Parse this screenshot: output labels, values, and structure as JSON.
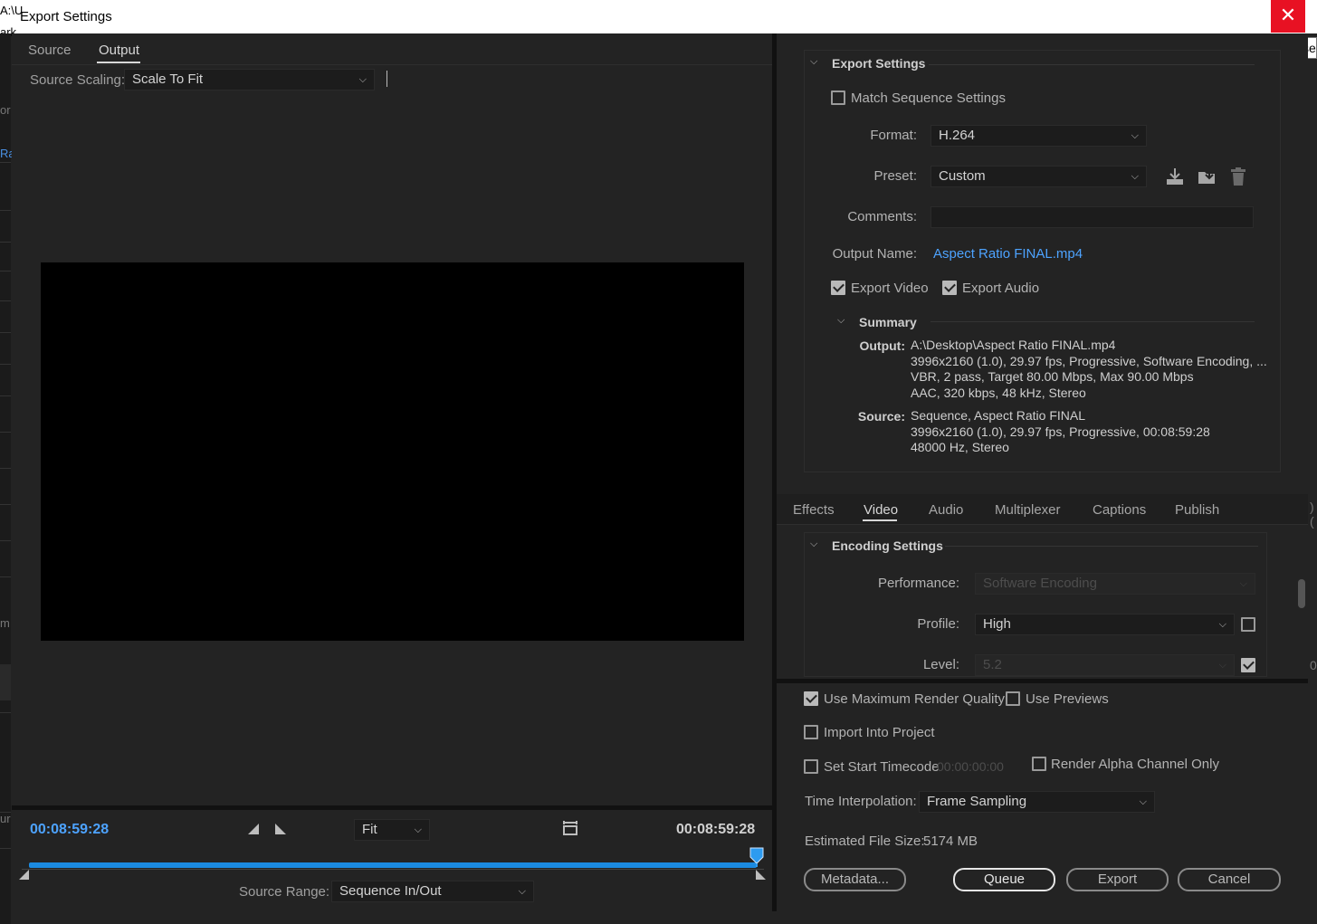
{
  "window": {
    "title": "Export Settings",
    "close_glyph": "✕",
    "close_tooltip": "Close"
  },
  "background_fragments": {
    "tl1": "A:\\U",
    "tl2": "ark",
    "or": "or",
    "ra": "Ra",
    "m": "m",
    "ur": "ur",
    "right1": ")(",
    "right2": "0"
  },
  "left_panel": {
    "tabs": [
      {
        "label": "Source"
      },
      {
        "label": "Output",
        "active": true
      }
    ],
    "source_scaling_label": "Source Scaling:",
    "source_scaling_value": "Scale To Fit",
    "timecode_in": "00:08:59:28",
    "timecode_out": "00:08:59:28",
    "zoom_value": "Fit",
    "source_range_label": "Source Range:",
    "source_range_value": "Sequence In/Out"
  },
  "export_settings": {
    "section_title": "Export Settings",
    "match_sequence_label": "Match Sequence Settings",
    "match_sequence_checked": false,
    "format_label": "Format:",
    "format_value": "H.264",
    "preset_label": "Preset:",
    "preset_value": "Custom",
    "comments_label": "Comments:",
    "comments_value": "",
    "output_name_label": "Output Name:",
    "output_name_value": "Aspect Ratio FINAL.mp4",
    "export_video_label": "Export Video",
    "export_video_checked": true,
    "export_audio_label": "Export Audio",
    "export_audio_checked": true
  },
  "summary": {
    "title": "Summary",
    "output_key": "Output:",
    "output_lines": [
      "A:\\Desktop\\Aspect Ratio FINAL.mp4",
      "3996x2160 (1.0), 29.97 fps, Progressive, Software Encoding, ...",
      "VBR, 2 pass, Target 80.00 Mbps, Max 90.00 Mbps",
      "AAC, 320 kbps, 48 kHz, Stereo"
    ],
    "source_key": "Source:",
    "source_lines": [
      "Sequence, Aspect Ratio FINAL",
      "3996x2160 (1.0), 29.97 fps, Progressive, 00:08:59:28",
      "48000 Hz, Stereo"
    ]
  },
  "settings_tabs": [
    {
      "label": "Effects"
    },
    {
      "label": "Video",
      "active": true
    },
    {
      "label": "Audio"
    },
    {
      "label": "Multiplexer"
    },
    {
      "label": "Captions"
    },
    {
      "label": "Publish"
    }
  ],
  "encoding": {
    "section_title": "Encoding Settings",
    "performance_label": "Performance:",
    "performance_value": "Software Encoding",
    "profile_label": "Profile:",
    "profile_value": "High",
    "profile_checked": false,
    "level_label": "Level:",
    "level_value": "5.2",
    "level_checked": true
  },
  "bottom": {
    "max_render_label": "Use Maximum Render Quality",
    "max_render_checked": true,
    "use_previews_label": "Use Previews",
    "use_previews_checked": false,
    "import_project_label": "Import Into Project",
    "import_project_checked": false,
    "start_timecode_label": "Set Start Timecode",
    "start_timecode_checked": false,
    "start_timecode_value": "00:00:00:00",
    "alpha_only_label": "Render Alpha Channel Only",
    "alpha_only_checked": false,
    "time_interp_label": "Time Interpolation:",
    "time_interp_value": "Frame Sampling",
    "file_size_label": "Estimated File Size:",
    "file_size_value": "5174 MB",
    "metadata_button": "Metadata...",
    "queue_button": "Queue",
    "export_button": "Export",
    "cancel_button": "Cancel"
  },
  "colors": {
    "accent_blue": "#4da3ff",
    "timeline_blue": "#1b8ae0",
    "close_red": "#e81123",
    "panel_bg": "#232323"
  }
}
